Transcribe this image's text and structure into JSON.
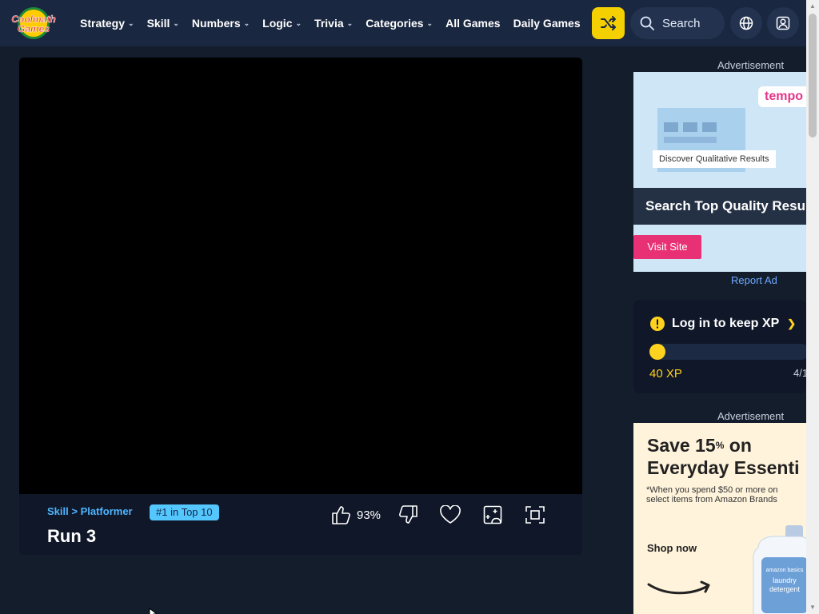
{
  "header": {
    "logo_text": [
      "Coolmath",
      "Games"
    ],
    "nav": [
      {
        "label": "Strategy",
        "has_dropdown": true
      },
      {
        "label": "Skill",
        "has_dropdown": true
      },
      {
        "label": "Numbers",
        "has_dropdown": true
      },
      {
        "label": "Logic",
        "has_dropdown": true
      },
      {
        "label": "Trivia",
        "has_dropdown": true
      },
      {
        "label": "Categories",
        "has_dropdown": true
      },
      {
        "label": "All Games",
        "has_dropdown": false
      },
      {
        "label": "Daily Games",
        "has_dropdown": false
      }
    ],
    "random_icon": "shuffle-icon",
    "search_placeholder": "Search",
    "globe_icon": "globe-icon",
    "account_icon": "user-icon"
  },
  "game": {
    "breadcrumb": {
      "category": "Skill",
      "separator": ">",
      "subcategory": "Platformer"
    },
    "rank_badge": "#1 in Top 10",
    "title": "Run 3",
    "like_percent": "93%",
    "action_icons": [
      "thumbs-up-icon",
      "thumbs-down-icon",
      "heart-icon",
      "add-game-icon",
      "fullscreen-icon"
    ]
  },
  "sidebar": {
    "ad_label": "Advertisement",
    "ad1": {
      "brand": "tempo",
      "card_text": "Discover Qualitative Results",
      "banner": "Search Top Quality Resu",
      "button": "Visit Site"
    },
    "report_ad": "Report Ad",
    "xp": {
      "title": "Log in to keep XP",
      "current": "40 XP",
      "goal": "4/1",
      "progress_fraction": 0.1
    },
    "ad2_label": "Advertisement",
    "ad2": {
      "title_line1": "Save 15",
      "title_sup": "%",
      "title_line1_end": " on",
      "title_line2": "Everyday Essenti",
      "note": "*When you spend $50 or more on select items from Amazon Brands",
      "shop": "Shop now",
      "bottle_text": [
        "amazon basics",
        "laundry",
        "detergent"
      ]
    }
  },
  "colors": {
    "page_bg": "#141d2b",
    "header_bg": "#1a2740",
    "accent_yellow": "#f5d000",
    "link_blue": "#4fb4ff",
    "badge_bg": "#55c7ff"
  }
}
